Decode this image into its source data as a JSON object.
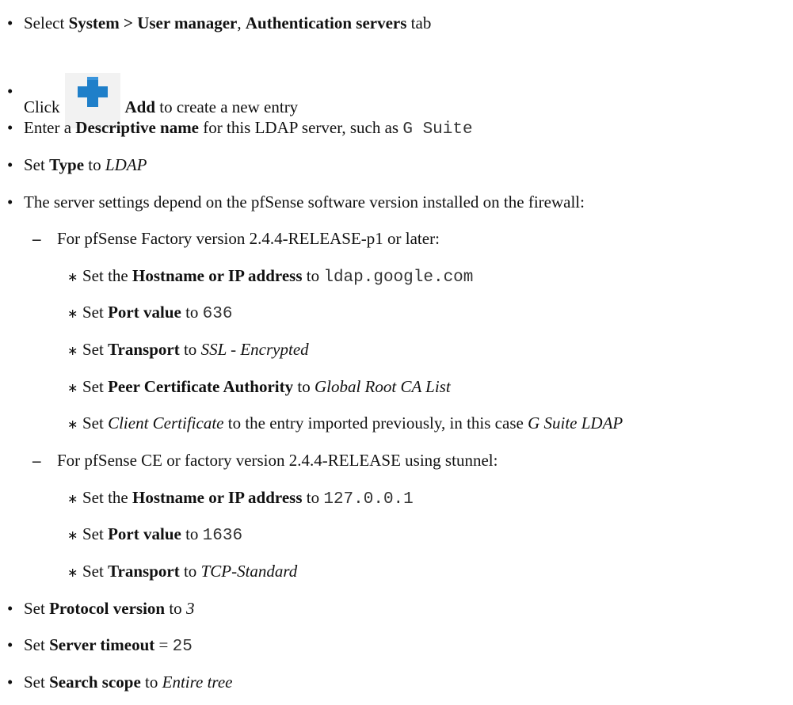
{
  "colors": {
    "text": "#111111",
    "mono_text": "#333333",
    "plus_icon_color": "#1f7fc9",
    "icon_background": "#f2f2f2"
  },
  "bullet_glyph": "•",
  "dash_glyph": "–",
  "star_glyph": "∗",
  "steps": {
    "s1": {
      "a": "Select ",
      "b": "System > User manager",
      "c": ", ",
      "d": "Authentication servers",
      "e": " tab"
    },
    "s2": {
      "a": "Click",
      "icon": "plus-icon",
      "b": "Add",
      "c": " to create a new entry"
    },
    "s3": {
      "a": "Enter a ",
      "b": "Descriptive name",
      "c": " for this LDAP server, such as ",
      "d": "G Suite"
    },
    "s4": {
      "a": "Set ",
      "b": "Type",
      "c": " to ",
      "d": "LDAP"
    },
    "s5": {
      "a": "The server settings depend on the pfSense software version installed on the firewall:"
    },
    "s5a": {
      "a": "For pfSense Factory version 2.4.4-RELEASE-p1 or later:",
      "i1": {
        "a": "Set the ",
        "b": "Hostname or IP address",
        "c": " to ",
        "d": "ldap.google.com"
      },
      "i2": {
        "a": "Set ",
        "b": "Port value",
        "c": " to ",
        "d": "636"
      },
      "i3": {
        "a": "Set ",
        "b": "Transport",
        "c": " to ",
        "d": "SSL - Encrypted"
      },
      "i4": {
        "a": "Set ",
        "b": "Peer Certificate Authority",
        "c": " to ",
        "d": "Global Root CA List"
      },
      "i5": {
        "a": "Set ",
        "b": "Client Certificate",
        "c": " to the entry imported previously, in this case ",
        "d": "G Suite LDAP"
      }
    },
    "s5b": {
      "a": "For pfSense CE or factory version 2.4.4-RELEASE using stunnel:",
      "i1": {
        "a": "Set the ",
        "b": "Hostname or IP address",
        "c": " to ",
        "d": "127.0.0.1"
      },
      "i2": {
        "a": "Set ",
        "b": "Port value",
        "c": " to ",
        "d": "1636"
      },
      "i3": {
        "a": "Set ",
        "b": "Transport",
        "c": " to ",
        "d": "TCP-Standard"
      }
    },
    "s6": {
      "a": "Set ",
      "b": "Protocol version",
      "c": " to ",
      "d": "3"
    },
    "s7": {
      "a": "Set ",
      "b": "Server timeout",
      "c": " = ",
      "d": "25"
    },
    "s8": {
      "a": "Set ",
      "b": "Search scope",
      "c": " to ",
      "d": "Entire tree"
    }
  }
}
